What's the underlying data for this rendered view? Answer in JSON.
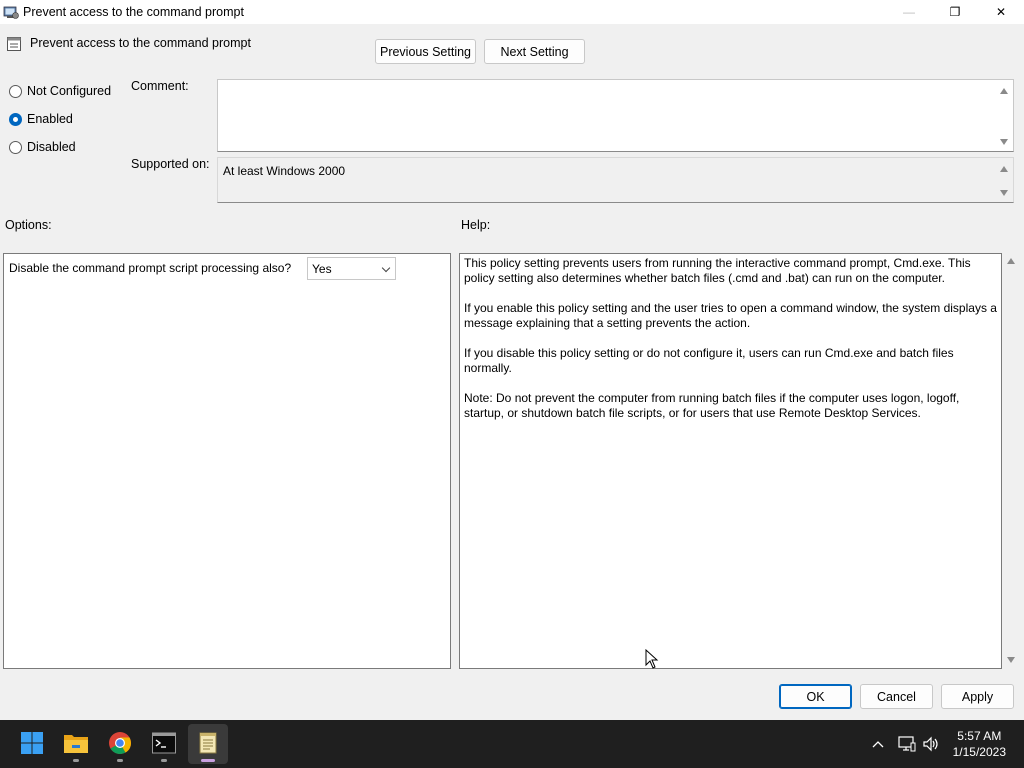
{
  "window": {
    "title": "Prevent access to the command prompt",
    "controls": {
      "minimize": "—",
      "maximize": "❐",
      "close": "✕"
    }
  },
  "header": {
    "policy_name": "Prevent access to the command prompt",
    "previous_label": "Previous Setting",
    "next_label": "Next Setting"
  },
  "state": {
    "options": [
      {
        "label": "Not Configured",
        "checked": false
      },
      {
        "label": "Enabled",
        "checked": true
      },
      {
        "label": "Disabled",
        "checked": false
      }
    ]
  },
  "comment": {
    "label": "Comment:",
    "value": ""
  },
  "supported": {
    "label": "Supported on:",
    "value": "At least Windows 2000"
  },
  "options_section": {
    "label": "Options:",
    "setting_label": "Disable the command prompt script processing also?",
    "setting_value": "Yes"
  },
  "help_section": {
    "label": "Help:",
    "paragraphs": [
      "This policy setting prevents users from running the interactive command prompt, Cmd.exe.  This policy setting also determines whether batch files (.cmd and .bat) can run on the computer.",
      "If you enable this policy setting and the user tries to open a command window, the system displays a message explaining that a setting prevents the action.",
      "If you disable this policy setting or do not configure it, users can run Cmd.exe and batch files normally.",
      "Note: Do not prevent the computer from running batch files if the computer uses logon, logoff, startup, or shutdown batch file scripts, or for users that use Remote Desktop Services."
    ]
  },
  "footer": {
    "ok_label": "OK",
    "cancel_label": "Cancel",
    "apply_label": "Apply"
  },
  "taskbar": {
    "apps": [
      "start-icon",
      "file-explorer-icon",
      "chrome-icon",
      "terminal-icon",
      "notepad-icon"
    ],
    "active_app": "notepad-icon",
    "tray_icons": [
      "chevron-up-icon",
      "network-icon",
      "volume-icon"
    ],
    "time": "5:57 AM",
    "date": "1/15/2023"
  },
  "colors": {
    "accent": "#0067c0",
    "taskbar": "#1f1f1f",
    "dialog_bg": "#f0f0f0"
  }
}
